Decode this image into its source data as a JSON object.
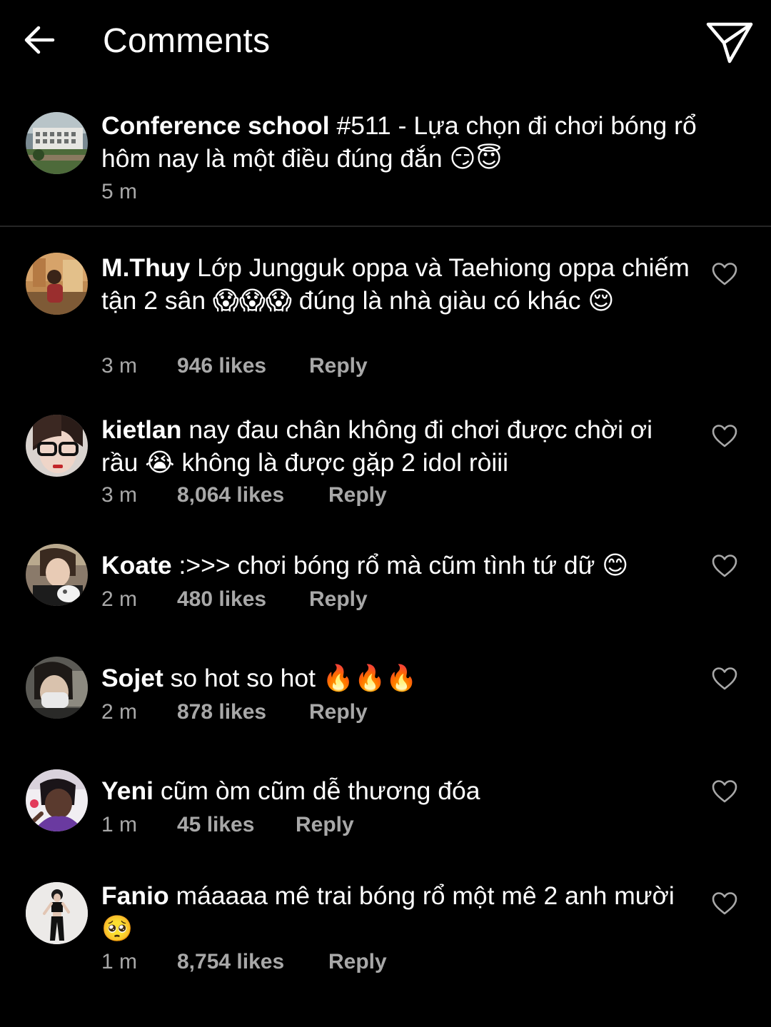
{
  "header": {
    "title": "Comments",
    "back_icon": "arrow-left-icon",
    "send_icon": "paper-plane-icon"
  },
  "caption": {
    "username": "Conference school",
    "text": "#511 - Lựa chọn đi chơi bóng rổ hôm nay là một điều đúng đắn 😏😇",
    "time": "5 m"
  },
  "comments": [
    {
      "username": "M.Thuy",
      "text": "Lớp Jungguk oppa và Taehiong oppa chiếm tận 2 sân 😱😱😱 đúng là nhà giàu có khác 😌",
      "time": "3 m",
      "likes": "946 likes",
      "reply": "Reply"
    },
    {
      "username": "kietlan",
      "text": "nay đau chân không đi chơi được chời ơi rầu 😭 không là được gặp 2 idol ròiii",
      "time": "3 m",
      "likes": "8,064 likes",
      "reply": "Reply"
    },
    {
      "username": "Koate",
      "text": ":>>> chơi bóng rổ mà cũm tình tứ dữ 😊",
      "time": "2 m",
      "likes": "480 likes",
      "reply": "Reply"
    },
    {
      "username": "Sojet",
      "text": "so hot so hot 🔥🔥🔥",
      "time": "2 m",
      "likes": "878 likes",
      "reply": "Reply"
    },
    {
      "username": "Yeni",
      "text": "cũm òm cũm dễ thương đóa",
      "time": "1 m",
      "likes": "45 likes",
      "reply": "Reply"
    },
    {
      "username": "Fanio",
      "text": "máaaaa mê trai bóng rổ một mê 2 anh mười 🥺",
      "time": "1 m",
      "likes": "8,754 likes",
      "reply": "Reply"
    }
  ],
  "colors": {
    "background": "#000000",
    "text": "#ffffff",
    "secondary_text": "#a8a8a8",
    "divider": "#262626"
  }
}
